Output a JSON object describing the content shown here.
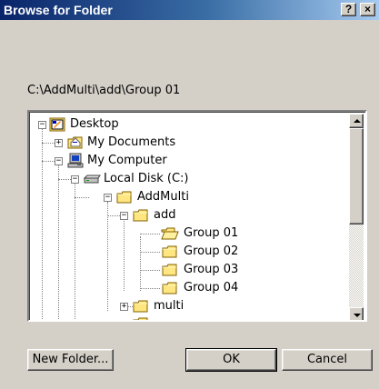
{
  "dialog": {
    "title": "Browse for Folder",
    "help_label": "?",
    "close_label": "×"
  },
  "current_path": "C:\\AddMulti\\add\\Group 01",
  "tree": {
    "items": [
      {
        "label": "Desktop",
        "icon": "desktop-icon",
        "expander": "−"
      },
      {
        "label": "My Documents",
        "icon": "folder-documents-icon",
        "expander": "+"
      },
      {
        "label": "My Computer",
        "icon": "computer-icon",
        "expander": "−"
      },
      {
        "label": "Local Disk (C:)",
        "icon": "drive-icon",
        "expander": "−"
      },
      {
        "label": "AddMulti",
        "icon": "folder-icon",
        "expander": "−"
      },
      {
        "label": "add",
        "icon": "folder-icon",
        "expander": "−"
      },
      {
        "label": "Group 01",
        "icon": "folder-open-icon",
        "expander": ""
      },
      {
        "label": "Group 02",
        "icon": "folder-icon",
        "expander": ""
      },
      {
        "label": "Group 03",
        "icon": "folder-icon",
        "expander": ""
      },
      {
        "label": "Group 04",
        "icon": "folder-icon",
        "expander": ""
      },
      {
        "label": "multi",
        "icon": "folder-icon",
        "expander": "+"
      }
    ]
  },
  "buttons": {
    "new_folder": "New Folder...",
    "ok": "OK",
    "cancel": "Cancel"
  },
  "colors": {
    "face": "#d4d0c8",
    "title_start": "#0a246a",
    "title_end": "#a6caf0",
    "folder": "#ffe680"
  }
}
